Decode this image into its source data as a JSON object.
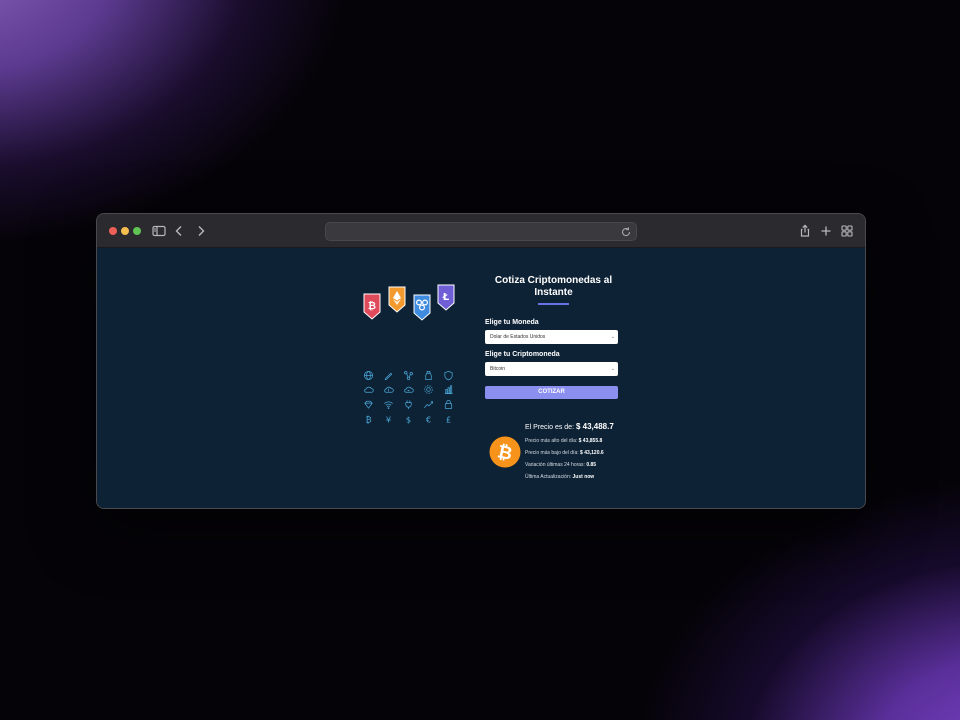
{
  "browser": {
    "url": ""
  },
  "illustration": {
    "badges": [
      {
        "name": "bitcoin",
        "glyph": "₿",
        "color": "#e04b5b"
      },
      {
        "name": "ethereum",
        "glyph": "Ξ",
        "color": "#f29a2e"
      },
      {
        "name": "ripple",
        "glyph": "◎",
        "color": "#3e8be0"
      },
      {
        "name": "litecoin",
        "glyph": "Ł",
        "color": "#6f5fd6"
      }
    ],
    "icon_color": "#4aa8d8"
  },
  "form": {
    "title": "Cotiza Criptomonedas al Instante",
    "currency_label": "Elige tu Moneda",
    "currency_value": "Dolar de Estados Unidos",
    "crypto_label": "Elige tu Criptomoneda",
    "crypto_value": "Bitcoin",
    "submit_label": "COTIZAR",
    "accent_color": "#8b8fef"
  },
  "result": {
    "price_label": "El Precio es de:",
    "price_value": "$ 43,488.7",
    "high_label": "Precio más alto del día:",
    "high_value": "$ 43,855.8",
    "low_label": "Precio más bajo del día:",
    "low_value": "$ 43,120.6",
    "change_label": "Variación últimas 24 horas:",
    "change_value": "0.85",
    "updated_label": "Última Actualización:",
    "updated_value": "Just now",
    "coin_color": "#f7931a"
  }
}
